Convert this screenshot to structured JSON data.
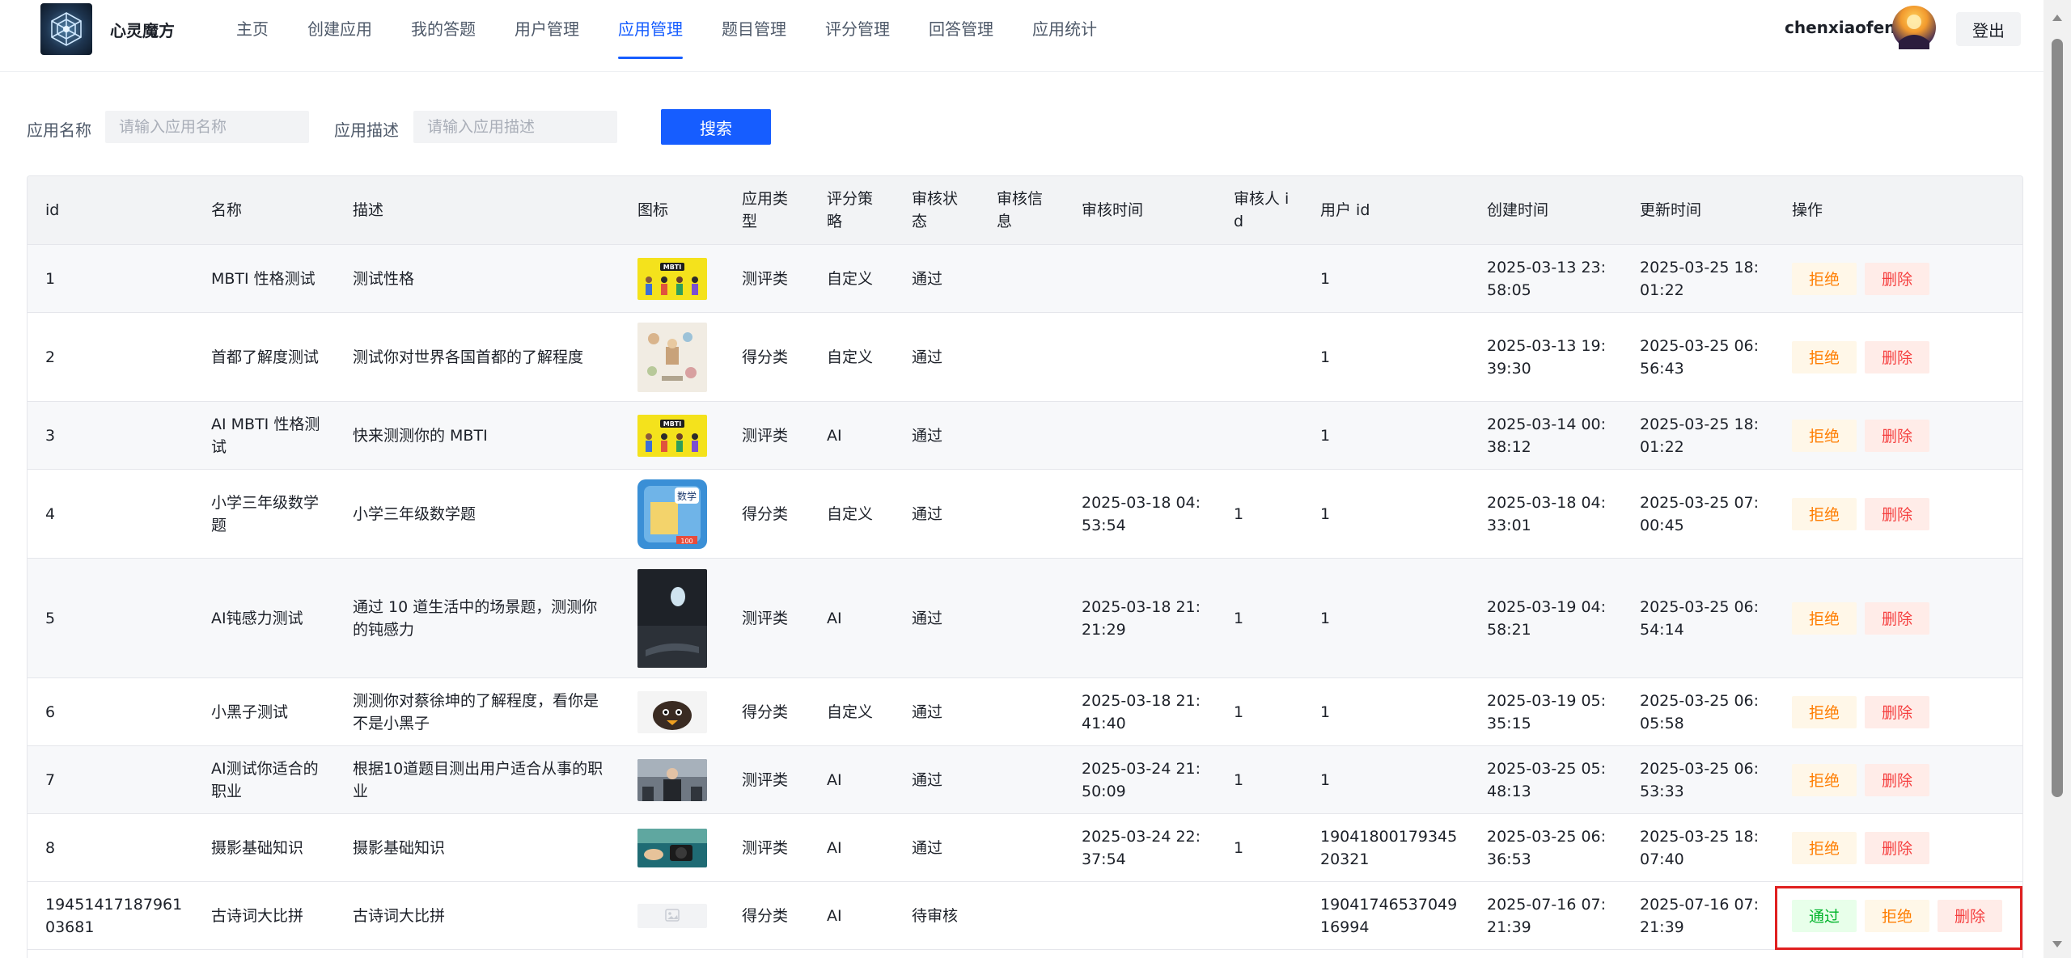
{
  "header": {
    "brand": "心灵魔方",
    "nav": [
      "主页",
      "创建应用",
      "我的答题",
      "用户管理",
      "应用管理",
      "题目管理",
      "评分管理",
      "回答管理",
      "应用统计"
    ],
    "active_nav": "应用管理",
    "username": "chenxiaofeng",
    "logout_label": "登出"
  },
  "search": {
    "name_label": "应用名称",
    "name_placeholder": "请输入应用名称",
    "name_value": "",
    "desc_label": "应用描述",
    "desc_placeholder": "请输入应用描述",
    "desc_value": "",
    "button_label": "搜索"
  },
  "table": {
    "columns": [
      "id",
      "名称",
      "描述",
      "图标",
      "应用类型",
      "评分策略",
      "审核状态",
      "审核信息",
      "审核时间",
      "审核人 id",
      "用户 id",
      "创建时间",
      "更新时间",
      "操作"
    ],
    "rows": [
      {
        "id": "1",
        "name": "MBTI 性格测试",
        "desc": "测试性格",
        "icon": "mbti",
        "type": "测评类",
        "strategy": "自定义",
        "status": "通过",
        "review_msg": "",
        "review_time": "",
        "reviewer_id": "",
        "user_id": "1",
        "create_time": "2025-03-13 23:58:05",
        "update_time": "2025-03-25 18:01:22",
        "actions": [
          "拒绝",
          "删除"
        ]
      },
      {
        "id": "2",
        "name": "首都了解度测试",
        "desc": "测试你对世界各国首都的了解程度",
        "icon": "capital",
        "type": "得分类",
        "strategy": "自定义",
        "status": "通过",
        "review_msg": "",
        "review_time": "",
        "reviewer_id": "",
        "user_id": "1",
        "create_time": "2025-03-13 19:39:30",
        "update_time": "2025-03-25 06:56:43",
        "actions": [
          "拒绝",
          "删除"
        ]
      },
      {
        "id": "3",
        "name": "AI MBTI 性格测试",
        "desc": "快来测测你的 MBTI",
        "icon": "mbti",
        "type": "测评类",
        "strategy": "AI",
        "status": "通过",
        "review_msg": "",
        "review_time": "",
        "reviewer_id": "",
        "user_id": "1",
        "create_time": "2025-03-14 00:38:12",
        "update_time": "2025-03-25 18:01:22",
        "actions": [
          "拒绝",
          "删除"
        ]
      },
      {
        "id": "4",
        "name": "小学三年级数学题",
        "desc": "小学三年级数学题",
        "icon": "math",
        "type": "得分类",
        "strategy": "自定义",
        "status": "通过",
        "review_msg": "",
        "review_time": "2025-03-18 04:53:54",
        "reviewer_id": "1",
        "user_id": "1",
        "create_time": "2025-03-18 04:33:01",
        "update_time": "2025-03-25 07:00:45",
        "actions": [
          "拒绝",
          "删除"
        ]
      },
      {
        "id": "5",
        "name": "AI钝感力测试",
        "desc": "通过 10 道生活中的场景题，测测你的钝感力",
        "icon": "dark",
        "type": "测评类",
        "strategy": "AI",
        "status": "通过",
        "review_msg": "",
        "review_time": "2025-03-18 21:21:29",
        "reviewer_id": "1",
        "user_id": "1",
        "create_time": "2025-03-19 04:58:21",
        "update_time": "2025-03-25 06:54:14",
        "actions": [
          "拒绝",
          "删除"
        ]
      },
      {
        "id": "6",
        "name": "小黑子测试",
        "desc": "测测你对蔡徐坤的了解程度，看你是不是小黑子",
        "icon": "chick",
        "type": "得分类",
        "strategy": "自定义",
        "status": "通过",
        "review_msg": "",
        "review_time": "2025-03-18 21:41:40",
        "reviewer_id": "1",
        "user_id": "1",
        "create_time": "2025-03-19 05:35:15",
        "update_time": "2025-03-25 06:05:58",
        "actions": [
          "拒绝",
          "删除"
        ]
      },
      {
        "id": "7",
        "name": "AI测试你适合的职业",
        "desc": "根据10道题目测出用户适合从事的职业",
        "icon": "career",
        "type": "测评类",
        "strategy": "AI",
        "status": "通过",
        "review_msg": "",
        "review_time": "2025-03-24 21:50:09",
        "reviewer_id": "1",
        "user_id": "1",
        "create_time": "2025-03-25 05:48:13",
        "update_time": "2025-03-25 06:53:33",
        "actions": [
          "拒绝",
          "删除"
        ]
      },
      {
        "id": "8",
        "name": "摄影基础知识",
        "desc": "摄影基础知识",
        "icon": "photo",
        "type": "测评类",
        "strategy": "AI",
        "status": "通过",
        "review_msg": "",
        "review_time": "2025-03-24 22:37:54",
        "reviewer_id": "1",
        "user_id": "1904180017934520321",
        "create_time": "2025-03-25 06:36:53",
        "update_time": "2025-03-25 18:07:40",
        "actions": [
          "拒绝",
          "删除"
        ]
      },
      {
        "id": "1945141718796103681",
        "name": "古诗词大比拼",
        "desc": "古诗词大比拼",
        "icon": "placeholder",
        "type": "得分类",
        "strategy": "AI",
        "status": "待审核",
        "review_msg": "",
        "review_time": "",
        "reviewer_id": "",
        "user_id": "1904174653704916994",
        "create_time": "2025-07-16 07:21:39",
        "update_time": "2025-07-16 07:21:39",
        "actions": [
          "通过",
          "拒绝",
          "删除"
        ]
      }
    ]
  },
  "colors": {
    "primary": "#165dff",
    "approve": "#00b42a",
    "reject": "#ff7d00",
    "delete": "#f53f3f",
    "highlight": "#e02020"
  }
}
